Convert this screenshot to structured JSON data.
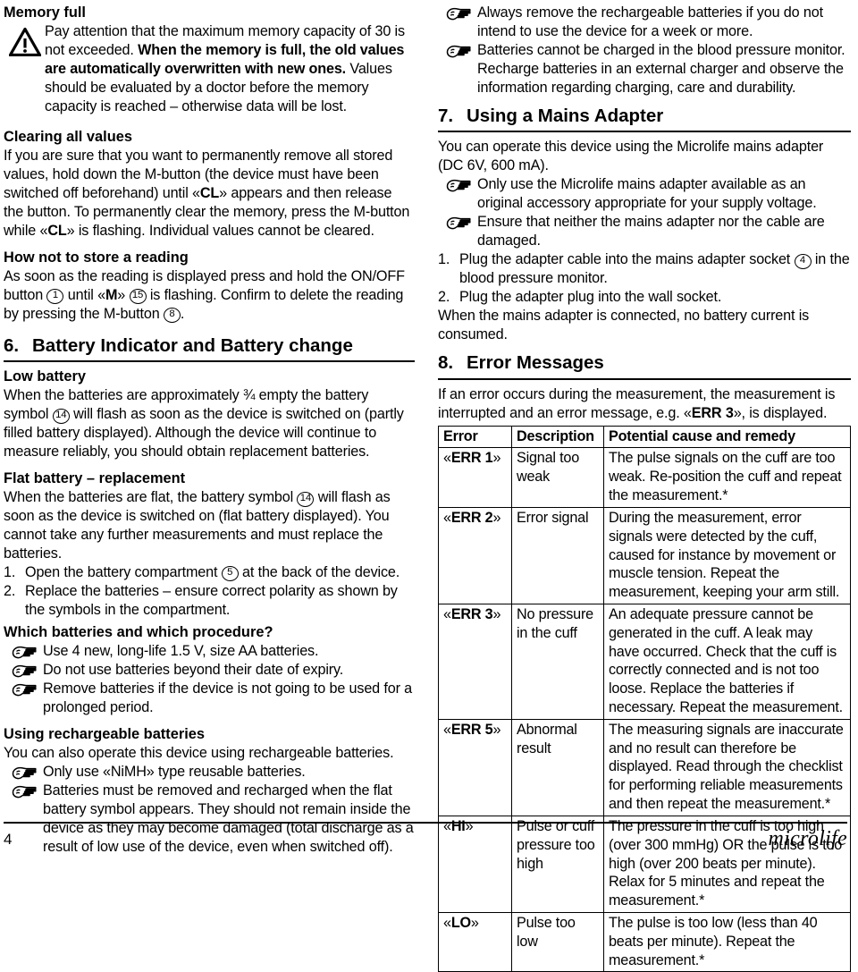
{
  "page": {
    "number": "4",
    "brand": "microlife"
  },
  "left_column": {
    "memory_full": {
      "heading": "Memory full",
      "icon": "warning-triangle-icon",
      "text_part1": "Pay attention that the maximum memory capacity of 30 is not exceeded. ",
      "text_bold": "When the memory is full, the old values are automatically overwritten with new ones.",
      "text_part2": " Values should be evaluated by a doctor before the memory capacity is reached – otherwise data will be lost."
    },
    "clearing_all_values": {
      "heading": "Clearing all values",
      "text_a": "If you are sure that you want to permanently remove all stored values, hold down the M-button (the device must have been switched off beforehand) until «",
      "bold_cl_1": "CL",
      "text_b": "» appears and then release the button. To permanently clear the memory, press the M-button while «",
      "bold_cl_2": "CL",
      "text_c": "» is flashing. Individual values cannot be cleared."
    },
    "how_not_to_store": {
      "heading": "How not to store a reading",
      "text_a": "As soon as the reading is displayed press and hold the ON/OFF button ",
      "ref_1": "1",
      "text_b": " until «",
      "bold_m": "M",
      "text_c": "» ",
      "ref_15": "15",
      "text_d": " is flashing. Confirm to delete the reading by pressing the M-button ",
      "ref_8": "8",
      "text_e": "."
    },
    "section6": {
      "number": "6.",
      "title": "Battery Indicator and Battery change"
    },
    "low_battery": {
      "heading": "Low battery",
      "text_a": "When the batteries are approximately ¾ empty the battery symbol ",
      "ref_14": "14",
      "text_b": " will flash as soon as the device is switched on (partly filled battery displayed). Although the device will continue to measure reliably, you should obtain replacement batteries."
    },
    "flat_battery": {
      "heading": "Flat battery – replacement",
      "text_a": "When the batteries are flat, the battery symbol ",
      "ref_14": "14",
      "text_b": " will flash as soon as the device is switched on (flat battery displayed). You cannot take any further measurements and must replace the batteries.",
      "items": [
        {
          "marker": "1.",
          "text_a": "Open the battery compartment ",
          "ref": "5",
          "text_b": " at the back of the device."
        },
        {
          "marker": "2.",
          "text_a": "Replace the batteries – ensure correct polarity as shown by the symbols in the compartment.",
          "ref": "",
          "text_b": ""
        }
      ]
    },
    "which_batteries": {
      "heading": "Which batteries and which procedure?",
      "bullets": [
        "Use 4 new, long-life 1.5 V, size AA batteries.",
        "Do not use batteries beyond their date of expiry.",
        "Remove batteries if the device is not going to be used for a prolonged period."
      ]
    },
    "rechargeable": {
      "heading": "Using rechargeable batteries",
      "intro": "You can also operate this device using rechargeable batteries.",
      "bullets": [
        "Only use «NiMH» type reusable batteries.",
        "Batteries must be removed and recharged when the flat battery symbol appears. They should not remain inside the device as they may become damaged (total discharge as a result of low use of the device, even when switched off)."
      ]
    }
  },
  "right_column": {
    "rechargeable_continued": {
      "bullets": [
        "Always remove the rechargeable batteries if you do not intend to use the device for a week or more.",
        "Batteries cannot be charged in the blood pressure monitor. Recharge batteries in an external charger and observe the information regarding charging, care and durability."
      ]
    },
    "section7": {
      "number": "7.",
      "title": "Using a Mains Adapter",
      "intro": "You can operate this device using the Microlife mains adapter (DC 6V, 600 mA).",
      "bullets": [
        "Only use the Microlife mains adapter available as an original accessory appropriate for your supply voltage.",
        "Ensure that neither the mains adapter nor the cable are damaged."
      ],
      "items": [
        {
          "marker": "1.",
          "text_a": "Plug the adapter cable into the mains adapter socket ",
          "ref": "4",
          "text_b": " in the blood pressure monitor."
        },
        {
          "marker": "2.",
          "text_a": "Plug the adapter plug into the wall socket.",
          "ref": "",
          "text_b": ""
        }
      ],
      "closing": "When the mains adapter is connected, no battery current is consumed."
    },
    "section8": {
      "number": "8.",
      "title": "Error Messages",
      "intro_a": "If an error occurs during the measurement, the measurement is interrupted and an error message, e.g. «",
      "intro_bold": "ERR 3",
      "intro_b": "», is displayed.",
      "table": {
        "headers": [
          "Error",
          "Description",
          "Potential cause and remedy"
        ],
        "rows": [
          {
            "error": "ERR 1",
            "description": "Signal too weak",
            "remedy": "The pulse signals on the cuff are too weak. Re-position the cuff and repeat the measurement.*"
          },
          {
            "error": "ERR 2",
            "description": "Error signal",
            "remedy": "During the measurement, error signals were detected by the cuff, caused for instance by movement or muscle tension. Repeat the measurement, keeping your arm still."
          },
          {
            "error": "ERR 3",
            "description": "No pressure in the cuff",
            "remedy": "An adequate pressure cannot be generated in the cuff. A leak may have occurred. Check that the cuff is correctly connected and is not too loose. Replace the batteries if necessary. Repeat the measurement."
          },
          {
            "error": "ERR 5",
            "description": "Abnormal result",
            "remedy": "The measuring signals are inaccurate and no result can therefore be displayed. Read through the checklist for performing reliable measurements and then repeat the measurement.*"
          },
          {
            "error": "HI",
            "description": "Pulse or cuff pressure too high",
            "remedy": "The pressure in the cuff is too high (over 300 mmHg) OR the pulse is too high (over 200 beats per minute). Relax for 5 minutes and repeat the measurement.*"
          },
          {
            "error": "LO",
            "description": "Pulse too low",
            "remedy": "The pulse is too low (less than 40 beats per minute). Repeat the measurement.*"
          }
        ]
      }
    }
  }
}
